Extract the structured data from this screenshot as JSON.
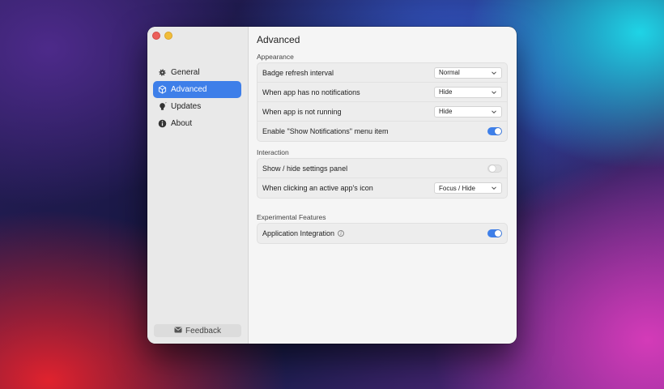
{
  "window": {
    "title": "Advanced"
  },
  "sidebar": {
    "items": [
      {
        "label": "General",
        "icon": "gear-icon",
        "active": false
      },
      {
        "label": "Advanced",
        "icon": "cube-icon",
        "active": true
      },
      {
        "label": "Updates",
        "icon": "lightbulb-icon",
        "active": false
      },
      {
        "label": "About",
        "icon": "info-icon",
        "active": false
      }
    ],
    "feedback_label": "Feedback"
  },
  "sections": {
    "appearance": {
      "label": "Appearance",
      "rows": [
        {
          "label": "Badge refresh interval",
          "control": "select",
          "value": "Normal"
        },
        {
          "label": "When app has no notifications",
          "control": "select",
          "value": "Hide"
        },
        {
          "label": "When app is not running",
          "control": "select",
          "value": "Hide"
        },
        {
          "label": "Enable \"Show Notifications\" menu item",
          "control": "toggle",
          "value": "on"
        }
      ]
    },
    "interaction": {
      "label": "Interaction",
      "rows": [
        {
          "label": "Show / hide settings panel",
          "control": "toggle",
          "value": "off"
        },
        {
          "label": "When clicking an active app's icon",
          "control": "select",
          "value": "Focus / Hide"
        }
      ]
    },
    "experimental": {
      "label": "Experimental Features",
      "rows": [
        {
          "label": "Application Integration",
          "control": "toggle",
          "value": "on"
        }
      ]
    }
  },
  "colors": {
    "accent": "#3e7fe9",
    "close": "#ec5f5a",
    "minimize": "#f1bd3a"
  }
}
